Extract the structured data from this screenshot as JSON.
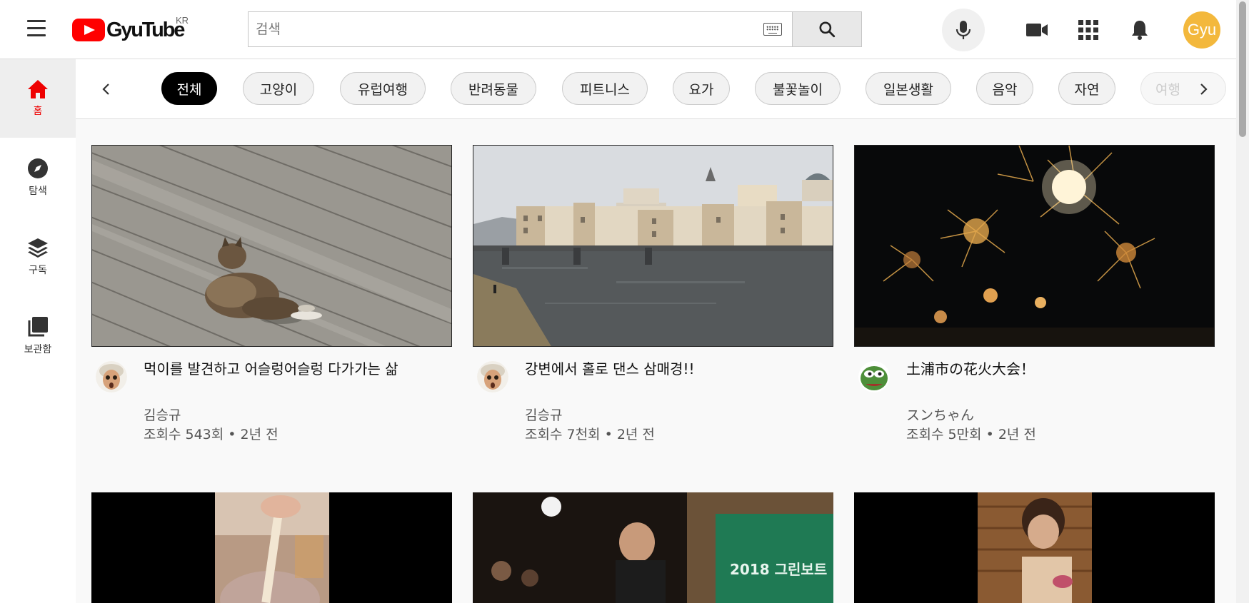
{
  "header": {
    "logo_text": "GyuTube",
    "logo_region": "KR",
    "search_placeholder": "검색",
    "avatar_text": "Gyu"
  },
  "icons": {
    "menu": "hamburger-icon",
    "keyboard": "keyboard-icon",
    "search": "search-icon",
    "mic": "mic-icon",
    "create": "video-camera-icon",
    "apps": "apps-grid-icon",
    "notifications": "bell-icon"
  },
  "sidebar": {
    "items": [
      {
        "label": "홈",
        "icon": "home-icon"
      },
      {
        "label": "탐색",
        "icon": "compass-icon"
      },
      {
        "label": "구독",
        "icon": "subscriptions-icon"
      },
      {
        "label": "보관함",
        "icon": "library-icon"
      }
    ]
  },
  "chips": [
    "전체",
    "고양이",
    "유럽여행",
    "반려동물",
    "피트니스",
    "요가",
    "불꽃놀이",
    "일본생활",
    "음악",
    "자연",
    "여행"
  ],
  "videos": [
    {
      "title": "먹이를 발견하고 어슬렁어슬렁 다가가는 삶",
      "channel": "김승규",
      "views": "조회수 543회",
      "age": "2년 전",
      "meta": "조회수 543회 • 2년 전"
    },
    {
      "title": "강변에서 홀로 댄스 삼매경!!",
      "channel": "김승규",
      "views": "조회수 7천회",
      "age": "2년 전",
      "meta": "조회수 7천회 • 2년 전"
    },
    {
      "title": "土浦市の花火大会！",
      "channel": "スンちゃん",
      "views": "조회수 5만회",
      "age": "2년 전",
      "meta": "조회수 5만회 • 2년 전"
    }
  ],
  "thumbnail_texts": {
    "poster_year": "2018 그린보트"
  },
  "colors": {
    "accent_red": "#ff0000",
    "avatar_bg": "#f3b83c",
    "active_chip": "#000000"
  }
}
